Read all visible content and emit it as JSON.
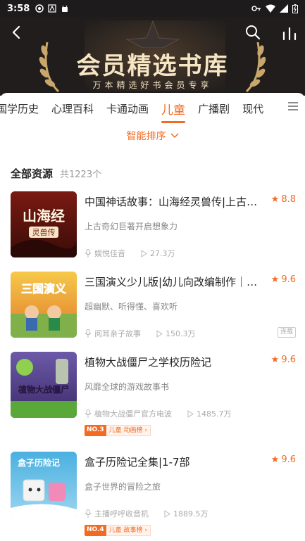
{
  "status": {
    "time": "3:58"
  },
  "hero": {
    "title": "会员精选书库",
    "subtitle": "万本精选好书会员专享"
  },
  "tabs": [
    {
      "label": "国学历史"
    },
    {
      "label": "心理百科"
    },
    {
      "label": "卡通动画"
    },
    {
      "label": "儿童",
      "active": true
    },
    {
      "label": "广播剧"
    },
    {
      "label": "现代"
    }
  ],
  "filter": {
    "sort_label": "智能排序"
  },
  "section": {
    "title": "全部资源",
    "count": "共1223个"
  },
  "items": [
    {
      "title": "中国神话故事：山海经灵兽传|上古未…",
      "rating": "8.8",
      "desc": "上古奇幻巨著开启想象力",
      "author": "娱悦佳音",
      "plays": "27.3万",
      "cover_text": "山海经",
      "cover_sub": "灵兽传"
    },
    {
      "title": "三国演义少儿版|幼儿向改编制作｜儿…",
      "rating": "9.6",
      "desc": "超幽默、听得懂、喜欢听",
      "author": "阅耳亲子故事",
      "plays": "150.3万",
      "tag": "连载",
      "cover_text": "三国演义"
    },
    {
      "title": "植物大战僵尸之学校历险记",
      "rating": "9.6",
      "desc": "风靡全球的游戏故事书",
      "author": "植物大战僵尸官方电波",
      "plays": "1485.7万",
      "rank_no": "NO.3",
      "rank_label": "儿童 动画榜 ›",
      "cover_text": "植物大战僵尸"
    },
    {
      "title": "盒子历险记全集|1-7部",
      "rating": "9.6",
      "desc": "盒子世界的冒险之旅",
      "author": "主播呼呼收音机",
      "plays": "1889.5万",
      "rank_no": "NO.4",
      "rank_label": "儿童 故事榜 ›",
      "cover_text": "盒子历险记"
    }
  ]
}
